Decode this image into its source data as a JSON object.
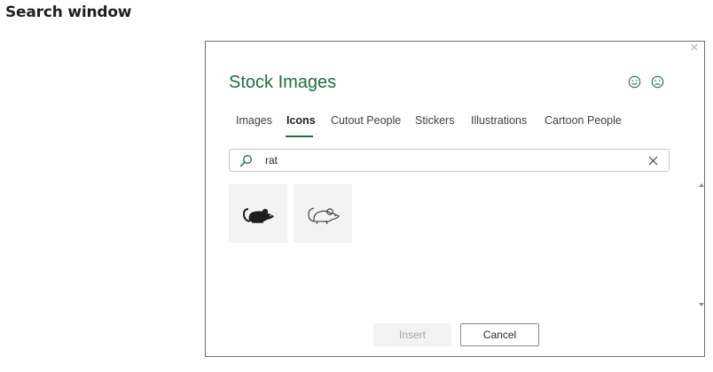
{
  "page": {
    "heading": "Search window"
  },
  "dialog": {
    "title": "Stock Images",
    "close_icon": "close-icon",
    "feedback": {
      "happy_icon": "smile-face-icon",
      "sad_icon": "frown-face-icon"
    },
    "tabs": [
      {
        "label": "Images",
        "active": false
      },
      {
        "label": "Icons",
        "active": true
      },
      {
        "label": "Cutout People",
        "active": false
      },
      {
        "label": "Stickers",
        "active": false
      },
      {
        "label": "Illustrations",
        "active": false
      },
      {
        "label": "Cartoon People",
        "active": false
      }
    ],
    "search": {
      "value": "rat",
      "placeholder": ""
    },
    "results": [
      {
        "icon": "rat-filled-icon"
      },
      {
        "icon": "rat-outline-icon"
      }
    ],
    "buttons": {
      "insert": "Insert",
      "cancel": "Cancel"
    }
  },
  "colors": {
    "accent": "#1e6e3e",
    "thumb_bg": "#f3f3f3",
    "disabled_text": "#a6a6a6"
  }
}
